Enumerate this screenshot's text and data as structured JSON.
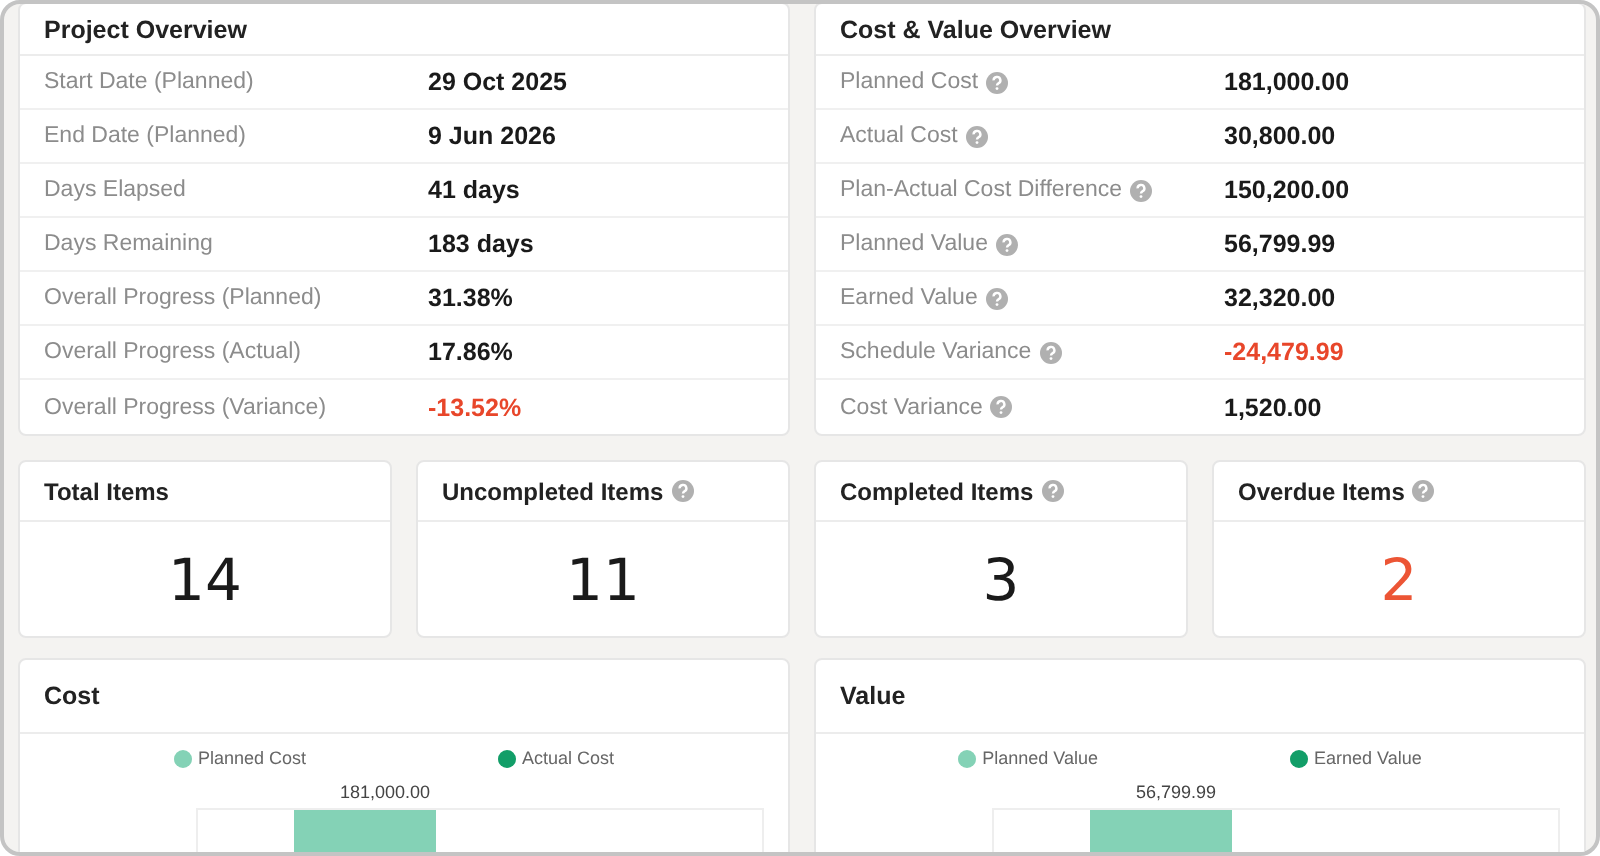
{
  "overviews": [
    {
      "title": "Project Overview",
      "rows": [
        {
          "label": "Start Date (Planned)",
          "value": "29 Oct 2025",
          "help": false,
          "negative": false
        },
        {
          "label": "End Date (Planned)",
          "value": "9 Jun 2026",
          "help": false,
          "negative": false
        },
        {
          "label": "Days Elapsed",
          "value": "41 days",
          "help": false,
          "negative": false
        },
        {
          "label": "Days Remaining",
          "value": "183 days",
          "help": false,
          "negative": false
        },
        {
          "label": "Overall Progress (Planned)",
          "value": "31.38%",
          "help": false,
          "negative": false
        },
        {
          "label": "Overall Progress (Actual)",
          "value": "17.86%",
          "help": false,
          "negative": false
        },
        {
          "label": "Overall Progress (Variance)",
          "value": "-13.52%",
          "help": false,
          "negative": true
        }
      ]
    },
    {
      "title": "Cost & Value Overview",
      "rows": [
        {
          "label": "Planned Cost",
          "value": "181,000.00",
          "help": true,
          "negative": false
        },
        {
          "label": "Actual Cost",
          "value": "30,800.00",
          "help": true,
          "negative": false
        },
        {
          "label": "Plan-Actual Cost Difference",
          "value": "150,200.00",
          "help": true,
          "negative": false
        },
        {
          "label": "Planned Value",
          "value": "56,799.99",
          "help": true,
          "negative": false
        },
        {
          "label": "Earned Value",
          "value": "32,320.00",
          "help": true,
          "negative": false
        },
        {
          "label": "Schedule Variance",
          "value": "-24,479.99",
          "help": true,
          "negative": true
        },
        {
          "label": "Cost Variance",
          "value": "1,520.00",
          "help": true,
          "negative": false
        }
      ]
    }
  ],
  "stats": [
    {
      "title": "Total Items",
      "value": "14",
      "help": false,
      "alert": false
    },
    {
      "title": "Uncompleted Items",
      "value": "11",
      "help": true,
      "alert": false
    },
    {
      "title": "Completed Items",
      "value": "3",
      "help": true,
      "alert": false
    },
    {
      "title": "Overdue Items",
      "value": "2",
      "help": true,
      "alert": true
    }
  ],
  "charts": [
    {
      "title": "Cost",
      "legend": [
        {
          "name": "Planned Cost",
          "color": "#84d2b6"
        },
        {
          "name": "Actual Cost",
          "color": "#129e68"
        }
      ],
      "bar_label": "181,000.00"
    },
    {
      "title": "Value",
      "legend": [
        {
          "name": "Planned Value",
          "color": "#84d2b6"
        },
        {
          "name": "Earned Value",
          "color": "#129e68"
        }
      ],
      "bar_label": "56,799.99"
    }
  ]
}
